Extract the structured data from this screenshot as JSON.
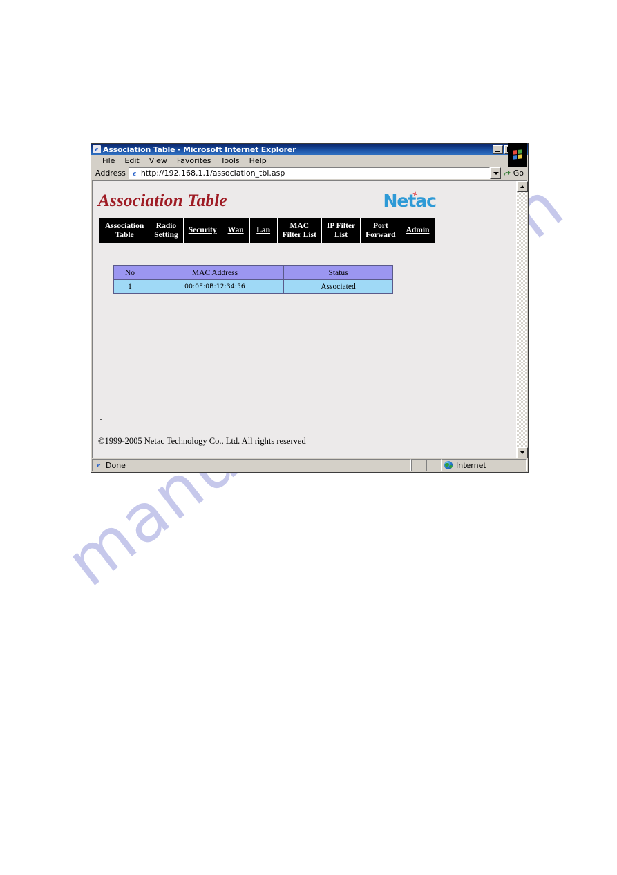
{
  "page": {
    "watermark": "manualshive.com"
  },
  "browser": {
    "title": "Association Table - Microsoft Internet Explorer",
    "title_icon": "ie-e-icon",
    "window_buttons": {
      "minimize": "minimize-button",
      "restore": "restore-button",
      "close": "close-button"
    },
    "menu": [
      "File",
      "Edit",
      "View",
      "Favorites",
      "Tools",
      "Help"
    ],
    "address": {
      "label": "Address",
      "value": "http://192.168.1.1/association_tbl.asp",
      "placeholder": "http://",
      "go_label": "Go"
    },
    "statusbar": {
      "status": "Done",
      "zone": "Internet"
    }
  },
  "webpage": {
    "heading": "Association Table",
    "logo": "Netac",
    "nav": [
      {
        "line1": "Association",
        "line2": "Table"
      },
      {
        "line1": "Radio",
        "line2": "Setting"
      },
      {
        "line1": "Security",
        "line2": ""
      },
      {
        "line1": "Wan",
        "line2": ""
      },
      {
        "line1": "Lan",
        "line2": ""
      },
      {
        "line1": "MAC",
        "line2": "Filter List"
      },
      {
        "line1": "IP Filter",
        "line2": "List"
      },
      {
        "line1": "Port",
        "line2": "Forward"
      },
      {
        "line1": "Admin",
        "line2": ""
      }
    ],
    "table": {
      "headers": [
        "No",
        "MAC Address",
        "Status"
      ],
      "rows": [
        {
          "no": "1",
          "mac": "00:0E:0B:12:34:56",
          "status": "Associated"
        }
      ]
    },
    "copyright": "©1999-2005 Netac Technology Co., Ltd. All rights reserved"
  },
  "colors": {
    "title_red": "#9e1b24",
    "logo_blue": "#2e9ad6",
    "logo_accent_red": "#e0242b",
    "table_header_bg": "#9b96f0",
    "table_row_bg": "#9fd9f6",
    "nav_bg": "#000000",
    "watermark": "#c3c6ea"
  }
}
